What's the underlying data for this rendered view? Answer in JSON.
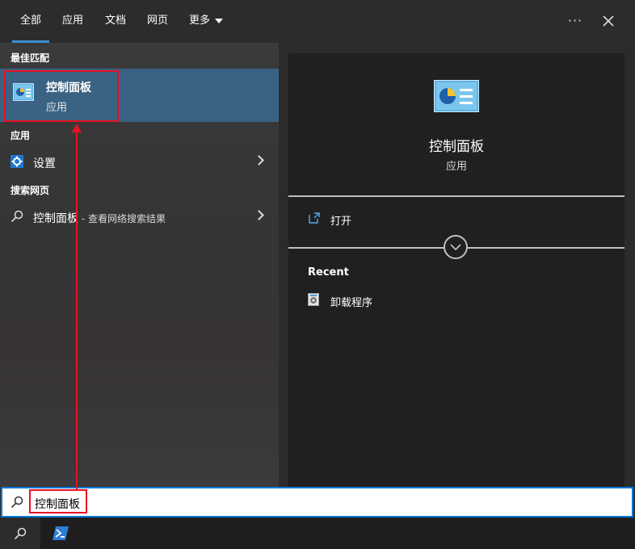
{
  "tabs": [
    {
      "label": "全部",
      "active": true
    },
    {
      "label": "应用"
    },
    {
      "label": "文档"
    },
    {
      "label": "网页"
    },
    {
      "label": "更多"
    }
  ],
  "sections": {
    "best_match": "最佳匹配",
    "apps": "应用",
    "web": "搜索网页"
  },
  "best_match_item": {
    "title": "控制面板",
    "subtitle": "应用"
  },
  "apps_item": {
    "label": "设置"
  },
  "web_item": {
    "label": "控制面板",
    "suffix": " - 查看网络搜索结果"
  },
  "detail": {
    "title": "控制面板",
    "subtitle": "应用",
    "open_label": "打开",
    "recent_header": "Recent",
    "recent_items": [
      "卸载程序"
    ]
  },
  "search": {
    "value": "控制面板"
  },
  "colors": {
    "accent": "#3e8fd4",
    "highlight_box": "#e81123",
    "selected_bg": "#3a6283"
  }
}
